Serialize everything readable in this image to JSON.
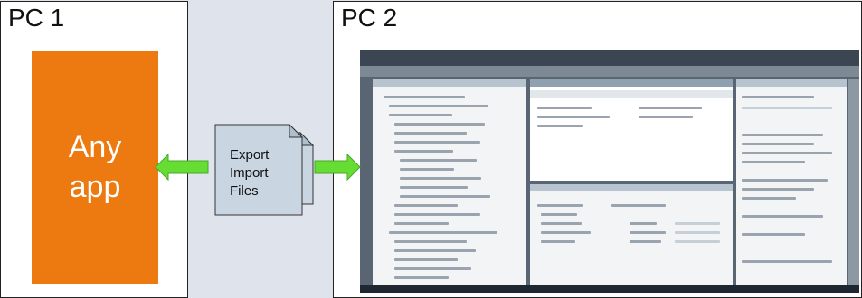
{
  "pc1": {
    "label": "PC 1",
    "app_box": {
      "line1": "Any",
      "line2": "app",
      "color": "#ec7a10"
    }
  },
  "pc2": {
    "label": "PC 2"
  },
  "files": {
    "line1": "Export",
    "line2": "Import",
    "line3": "Files",
    "color": "#c9d5e1"
  },
  "arrow_color": "#66dd33"
}
